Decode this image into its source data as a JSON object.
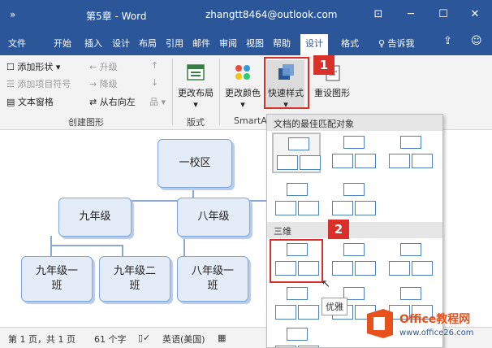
{
  "titlebar": {
    "quick_access": "»",
    "title": "第5章 - Word",
    "account": "zhangtt8464@outlook.com",
    "display_icon": "⊡",
    "minimize": "─",
    "restore": "☐",
    "close": "✕"
  },
  "tabs": [
    "文件",
    "开始",
    "插入",
    "设计",
    "布局",
    "引用",
    "邮件",
    "审阅",
    "视图",
    "帮助",
    "设计",
    "格式"
  ],
  "tell_me": "♀ 告诉我",
  "ribbon": {
    "create_graphic": {
      "add_shape": "添加形状 ▾",
      "add_bullet": "添加项目符号",
      "text_pane": "文本窗格",
      "promote": "← 升级",
      "demote": "→ 降级",
      "rtl": "从右向左",
      "group_label": "创建图形"
    },
    "layout_btn": "更改布局",
    "layout_group": "版式",
    "colors_btn": "更改颜色",
    "quick_styles_btn": "快速样式",
    "reset_btn": "重设图形",
    "smartart_group": "SmartA"
  },
  "gallery": {
    "best_match": "文档的最佳匹配对象",
    "three_d": "三维"
  },
  "badges": [
    "1",
    "2"
  ],
  "tooltip": "优雅",
  "orgchart": {
    "root": "一校区",
    "level2": [
      "九年级",
      "八年级"
    ],
    "level3": [
      "九年级一\n班",
      "九年级二\n班",
      "八年级一\n班"
    ]
  },
  "status": {
    "page": "第 1 页，共 1 页",
    "words": "61 个字",
    "lang": "英语(美国)"
  },
  "watermark": {
    "brand": "Office教程网",
    "url": "www.office26.com"
  }
}
